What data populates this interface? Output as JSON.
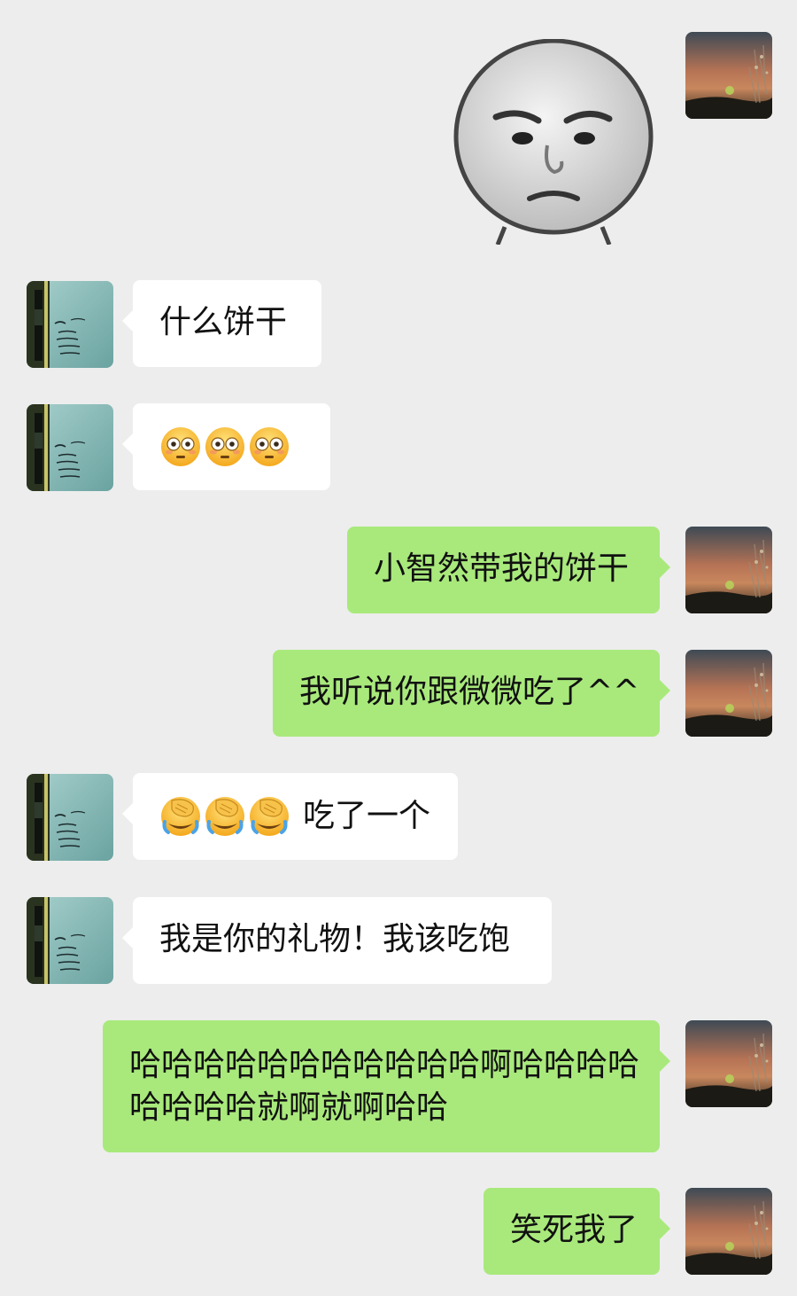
{
  "messages": [
    {
      "id": "m1",
      "side": "out",
      "kind": "sticker",
      "sticker": "grumpy-face-sticker"
    },
    {
      "id": "m2",
      "side": "in",
      "text": "什么饼干"
    },
    {
      "id": "m3",
      "side": "in",
      "kind": "emoji",
      "emoji": [
        "flushed-face",
        "flushed-face",
        "flushed-face"
      ]
    },
    {
      "id": "m4",
      "side": "out",
      "text": "小智然带我的饼干"
    },
    {
      "id": "m5",
      "side": "out",
      "text": "我听说你跟微微吃了^^"
    },
    {
      "id": "m6",
      "side": "in",
      "emoji": [
        "face-palm-crying",
        "face-palm-crying",
        "face-palm-crying"
      ],
      "text": "吃了一个"
    },
    {
      "id": "m7",
      "side": "in",
      "text": "我是你的礼物！我该吃饱"
    },
    {
      "id": "m8",
      "side": "out",
      "lines": [
        "哈哈哈哈哈哈哈哈哈哈哈啊哈哈哈哈",
        "哈哈哈哈就啊就啊哈哈"
      ]
    },
    {
      "id": "m9",
      "side": "out",
      "text": "笑死我了"
    }
  ],
  "colors": {
    "background": "#ededed",
    "incoming_bubble": "#ffffff",
    "outgoing_bubble": "#a9e97c"
  },
  "avatars": {
    "self": "sunset-avatar",
    "contact": "notebook-pen-avatar"
  }
}
